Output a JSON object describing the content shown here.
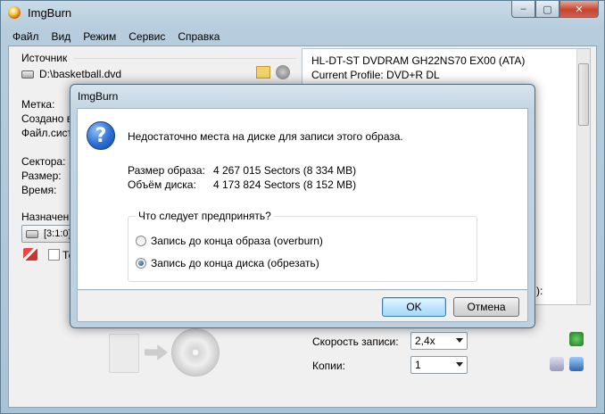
{
  "window": {
    "title": "ImgBurn",
    "min": "–",
    "max": "▢",
    "close": "✕"
  },
  "menu": [
    "Файл",
    "Вид",
    "Режим",
    "Сервис",
    "Справка"
  ],
  "source": {
    "label": "Источник",
    "path": "D:\\basketball.dvd"
  },
  "left_labels": {
    "metka": "Метка:",
    "created": "Создано в",
    "fs": "Файл.сист",
    "sectors": "Сектора:",
    "size": "Размер:",
    "time": "Время:",
    "dest": "Назначени",
    "dest_drive": "[3:1:0]",
    "test": "Те"
  },
  "drive_info": {
    "device": "HL-DT-ST DVDRAM GH22NS70 EX00 (ATA)",
    "profile": "Current Profile: DVD+R DL",
    "tail": "):"
  },
  "bottom": {
    "speed_label": "Скорость записи:",
    "speed_value": "2,4x",
    "copies_label": "Копии:",
    "copies_value": "1"
  },
  "dialog": {
    "title": "ImgBurn",
    "icon": "?",
    "message": "Недостаточно места на диске для записи этого образа.",
    "image_size_label": "Размер образа:",
    "image_size_value": "4 267 015 Sectors (8 334 MB)",
    "disc_size_label": "Объём диска:",
    "disc_size_value": "4 173 824 Sectors (8 152 MB)",
    "question": "Что следует предпринять?",
    "options": [
      {
        "label": "Запись до конца образа (overburn)",
        "checked": false
      },
      {
        "label": "Запись до конца диска (обрезать)",
        "checked": true
      }
    ],
    "ok": "OK",
    "cancel": "Отмена"
  }
}
